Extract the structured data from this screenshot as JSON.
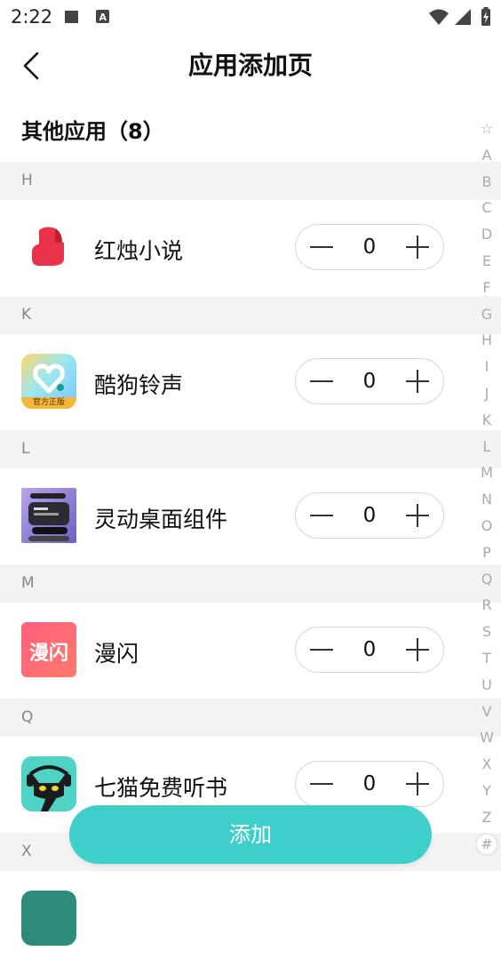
{
  "status": {
    "time": "2:22"
  },
  "header": {
    "title": "应用添加页"
  },
  "section": {
    "title": "其他应用（8）"
  },
  "groups": [
    {
      "letter": "H",
      "app": {
        "name": "红烛小说",
        "quantity": "0",
        "icon": "hongzhu-icon"
      }
    },
    {
      "letter": "K",
      "app": {
        "name": "酷狗铃声",
        "quantity": "0",
        "icon": "kugou-ringtone-icon",
        "badge": "官方正版"
      }
    },
    {
      "letter": "L",
      "app": {
        "name": "灵动桌面组件",
        "quantity": "0",
        "icon": "desktop-widget-icon"
      }
    },
    {
      "letter": "M",
      "app": {
        "name": "漫闪",
        "quantity": "0",
        "icon": "manshan-icon",
        "icon_text": "漫闪"
      }
    },
    {
      "letter": "Q",
      "app": {
        "name": "七猫免费听书",
        "quantity": "0",
        "icon": "qimao-cat-icon"
      }
    },
    {
      "letter": "X"
    }
  ],
  "alpha_index": [
    "☆",
    "A",
    "B",
    "C",
    "D",
    "E",
    "F",
    "G",
    "H",
    "I",
    "J",
    "K",
    "L",
    "M",
    "N",
    "O",
    "P",
    "Q",
    "R",
    "S",
    "T",
    "U",
    "V",
    "W",
    "X",
    "Y",
    "Z",
    "#"
  ],
  "actions": {
    "add_label": "添加"
  },
  "colors": {
    "accent": "#3ecfca",
    "section_bg": "#f3f3f3"
  }
}
